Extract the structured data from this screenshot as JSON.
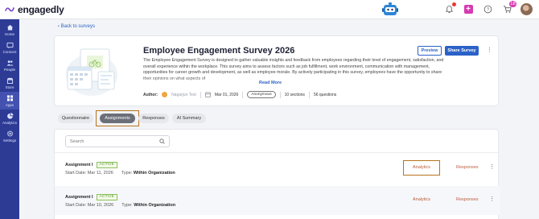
{
  "app": {
    "logo_text": "engagedly",
    "notification_count": "18",
    "add_symbol": "+"
  },
  "sidebar": {
    "items": [
      {
        "label": "Home",
        "icon": "home-icon"
      },
      {
        "label": "Connect",
        "icon": "connect-icon"
      },
      {
        "label": "People",
        "icon": "people-icon"
      },
      {
        "label": "Store",
        "icon": "store-icon"
      },
      {
        "label": "Apps",
        "icon": "apps-icon",
        "active": true
      },
      {
        "label": "Analytics",
        "icon": "analytics-icon"
      },
      {
        "label": "Settings",
        "icon": "settings-icon"
      }
    ]
  },
  "nav": {
    "back_label": "Back to surveys"
  },
  "survey": {
    "title": "Employee Engagement Survey 2026",
    "description": "The Employee Engagement Survey is designed to gather valuable insights and feedback from employees regarding their level of engagement, satisfaction, and overall experience within the workplace. This survey aims to assess factors such as job fulfillment, work environment, communication with management, opportunities for career growth and development, as well as employee morale. By actively participating in this survey, employees have the opportunity to share their opinions on what aspects of",
    "read_more": "Read More",
    "author_label": "Author:",
    "author_name": "Nagarjun Test",
    "date": "Mar 01, 2026",
    "visibility": "Anonymous",
    "sections": "10 sections",
    "questions": "56 questions",
    "preview_label": "Preview",
    "share_label": "Share Survey",
    "more_symbol": "⋮"
  },
  "tabs": [
    {
      "label": "Questionnaire",
      "active": false
    },
    {
      "label": "Assignments",
      "active": true
    },
    {
      "label": "Responses",
      "active": false
    },
    {
      "label": "AI Summary",
      "active": false
    }
  ],
  "search": {
    "placeholder": "Search"
  },
  "assignments": [
    {
      "name": "Assignment I",
      "status": "ACTIVE",
      "start_date_label": "Start Date:",
      "start_date": "Mar 11, 2026",
      "type_label": "Type:",
      "type": "Within Organization",
      "analytics_label": "Analytics",
      "responses_label": "Responses"
    },
    {
      "name": "Assignment I",
      "status": "ACTIVE",
      "start_date_label": "Start Date:",
      "start_date": "Mar 10, 2026",
      "type_label": "Type:",
      "type": "Within Organization",
      "analytics_label": "Analytics",
      "responses_label": "Responses"
    }
  ],
  "colors": {
    "sidebar": "#2d3b95",
    "primary": "#2c62c7",
    "highlight": "#b7731f",
    "active_tab": "#6b6f78",
    "status_green": "#5d9a2b",
    "action_link": "#b85d3c"
  }
}
